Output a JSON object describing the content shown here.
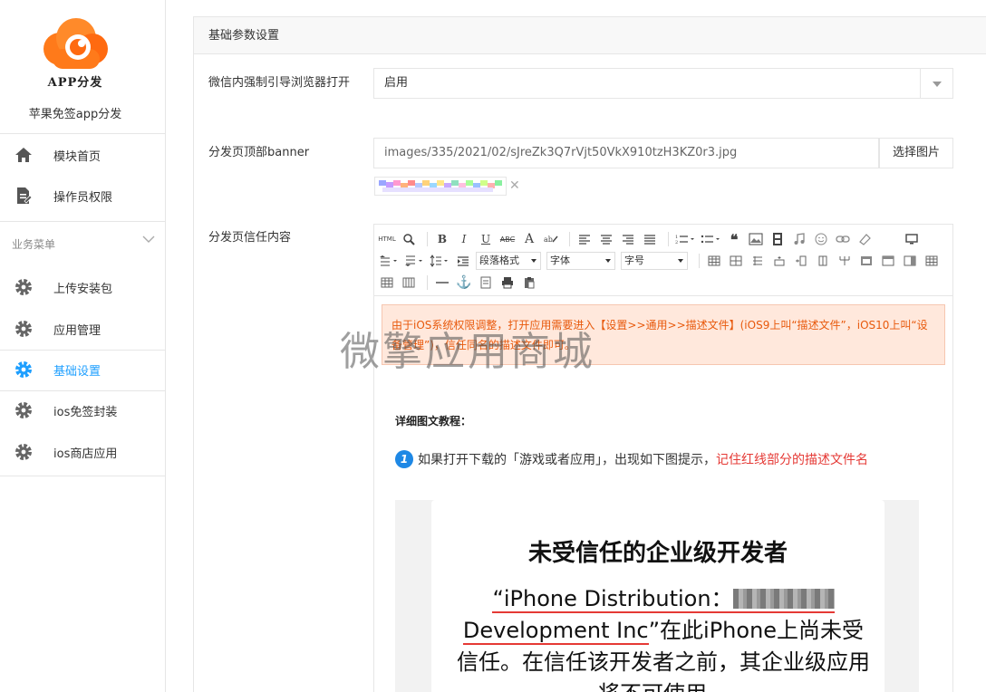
{
  "sidebar": {
    "logo_text": "APP分发",
    "subtitle": "苹果免签app分发",
    "top_items": [
      {
        "label": "模块首页",
        "icon": "home-icon"
      },
      {
        "label": "操作员权限",
        "icon": "document-icon"
      }
    ],
    "section_label": "业务菜单",
    "menu_items": [
      {
        "label": "上传安装包",
        "icon": "gear-icon"
      },
      {
        "label": "应用管理",
        "icon": "gear-icon"
      },
      {
        "label": "基础设置",
        "icon": "gear-icon",
        "active": true
      },
      {
        "label": "ios免签封装",
        "icon": "gear-icon"
      },
      {
        "label": "ios商店应用",
        "icon": "gear-icon"
      }
    ]
  },
  "panel": {
    "title": "基础参数设置",
    "fields": {
      "browser_label": "微信内强制引导浏览器打开",
      "browser_value": "启用",
      "banner_label": "分发页顶部banner",
      "banner_value": "images/335/2021/02/sJreZk3Q7rVjt50VkX910tzH3KZ0r3.jpg",
      "banner_button": "选择图片",
      "banner_remove": "✕",
      "trust_label": "分发页信任内容"
    }
  },
  "editor": {
    "toolbar": {
      "html": "HTML",
      "bold": "B",
      "italic": "I",
      "underline": "U",
      "strike": "ABC",
      "font_color": "A",
      "paragraph_select": "段落格式",
      "font_select": "字体",
      "size_select": "字号"
    },
    "notice": "由于iOS系统权限调整，打开应用需要进入【设置>>通用>>描述文件】(iOS9上叫“描述文件”，iOS10上叫“设备管理”)，信任同名的描述文件即可。",
    "tutorial_heading": "详细图文教程：",
    "step1_number": "1",
    "step1_text": "如果打开下载的「游戏或者应用」，出现如下图提示，",
    "step1_highlight": "记住红线部分的描述文件名",
    "shot_title": "未受信任的企业级开发者",
    "shot_line1": "“iPhone Distribution：",
    "shot_line2": "Development Inc",
    "shot_line2_rest": "”在此iPhone上尚未受信任。在信任该开发者之前，其企业级应用将不可使用。"
  },
  "watermark": "微擎应用商城",
  "colors": {
    "accent": "#1e9fff",
    "notice_text": "#e8590c",
    "notice_bg": "#ffe8dc",
    "highlight": "#e53935"
  }
}
